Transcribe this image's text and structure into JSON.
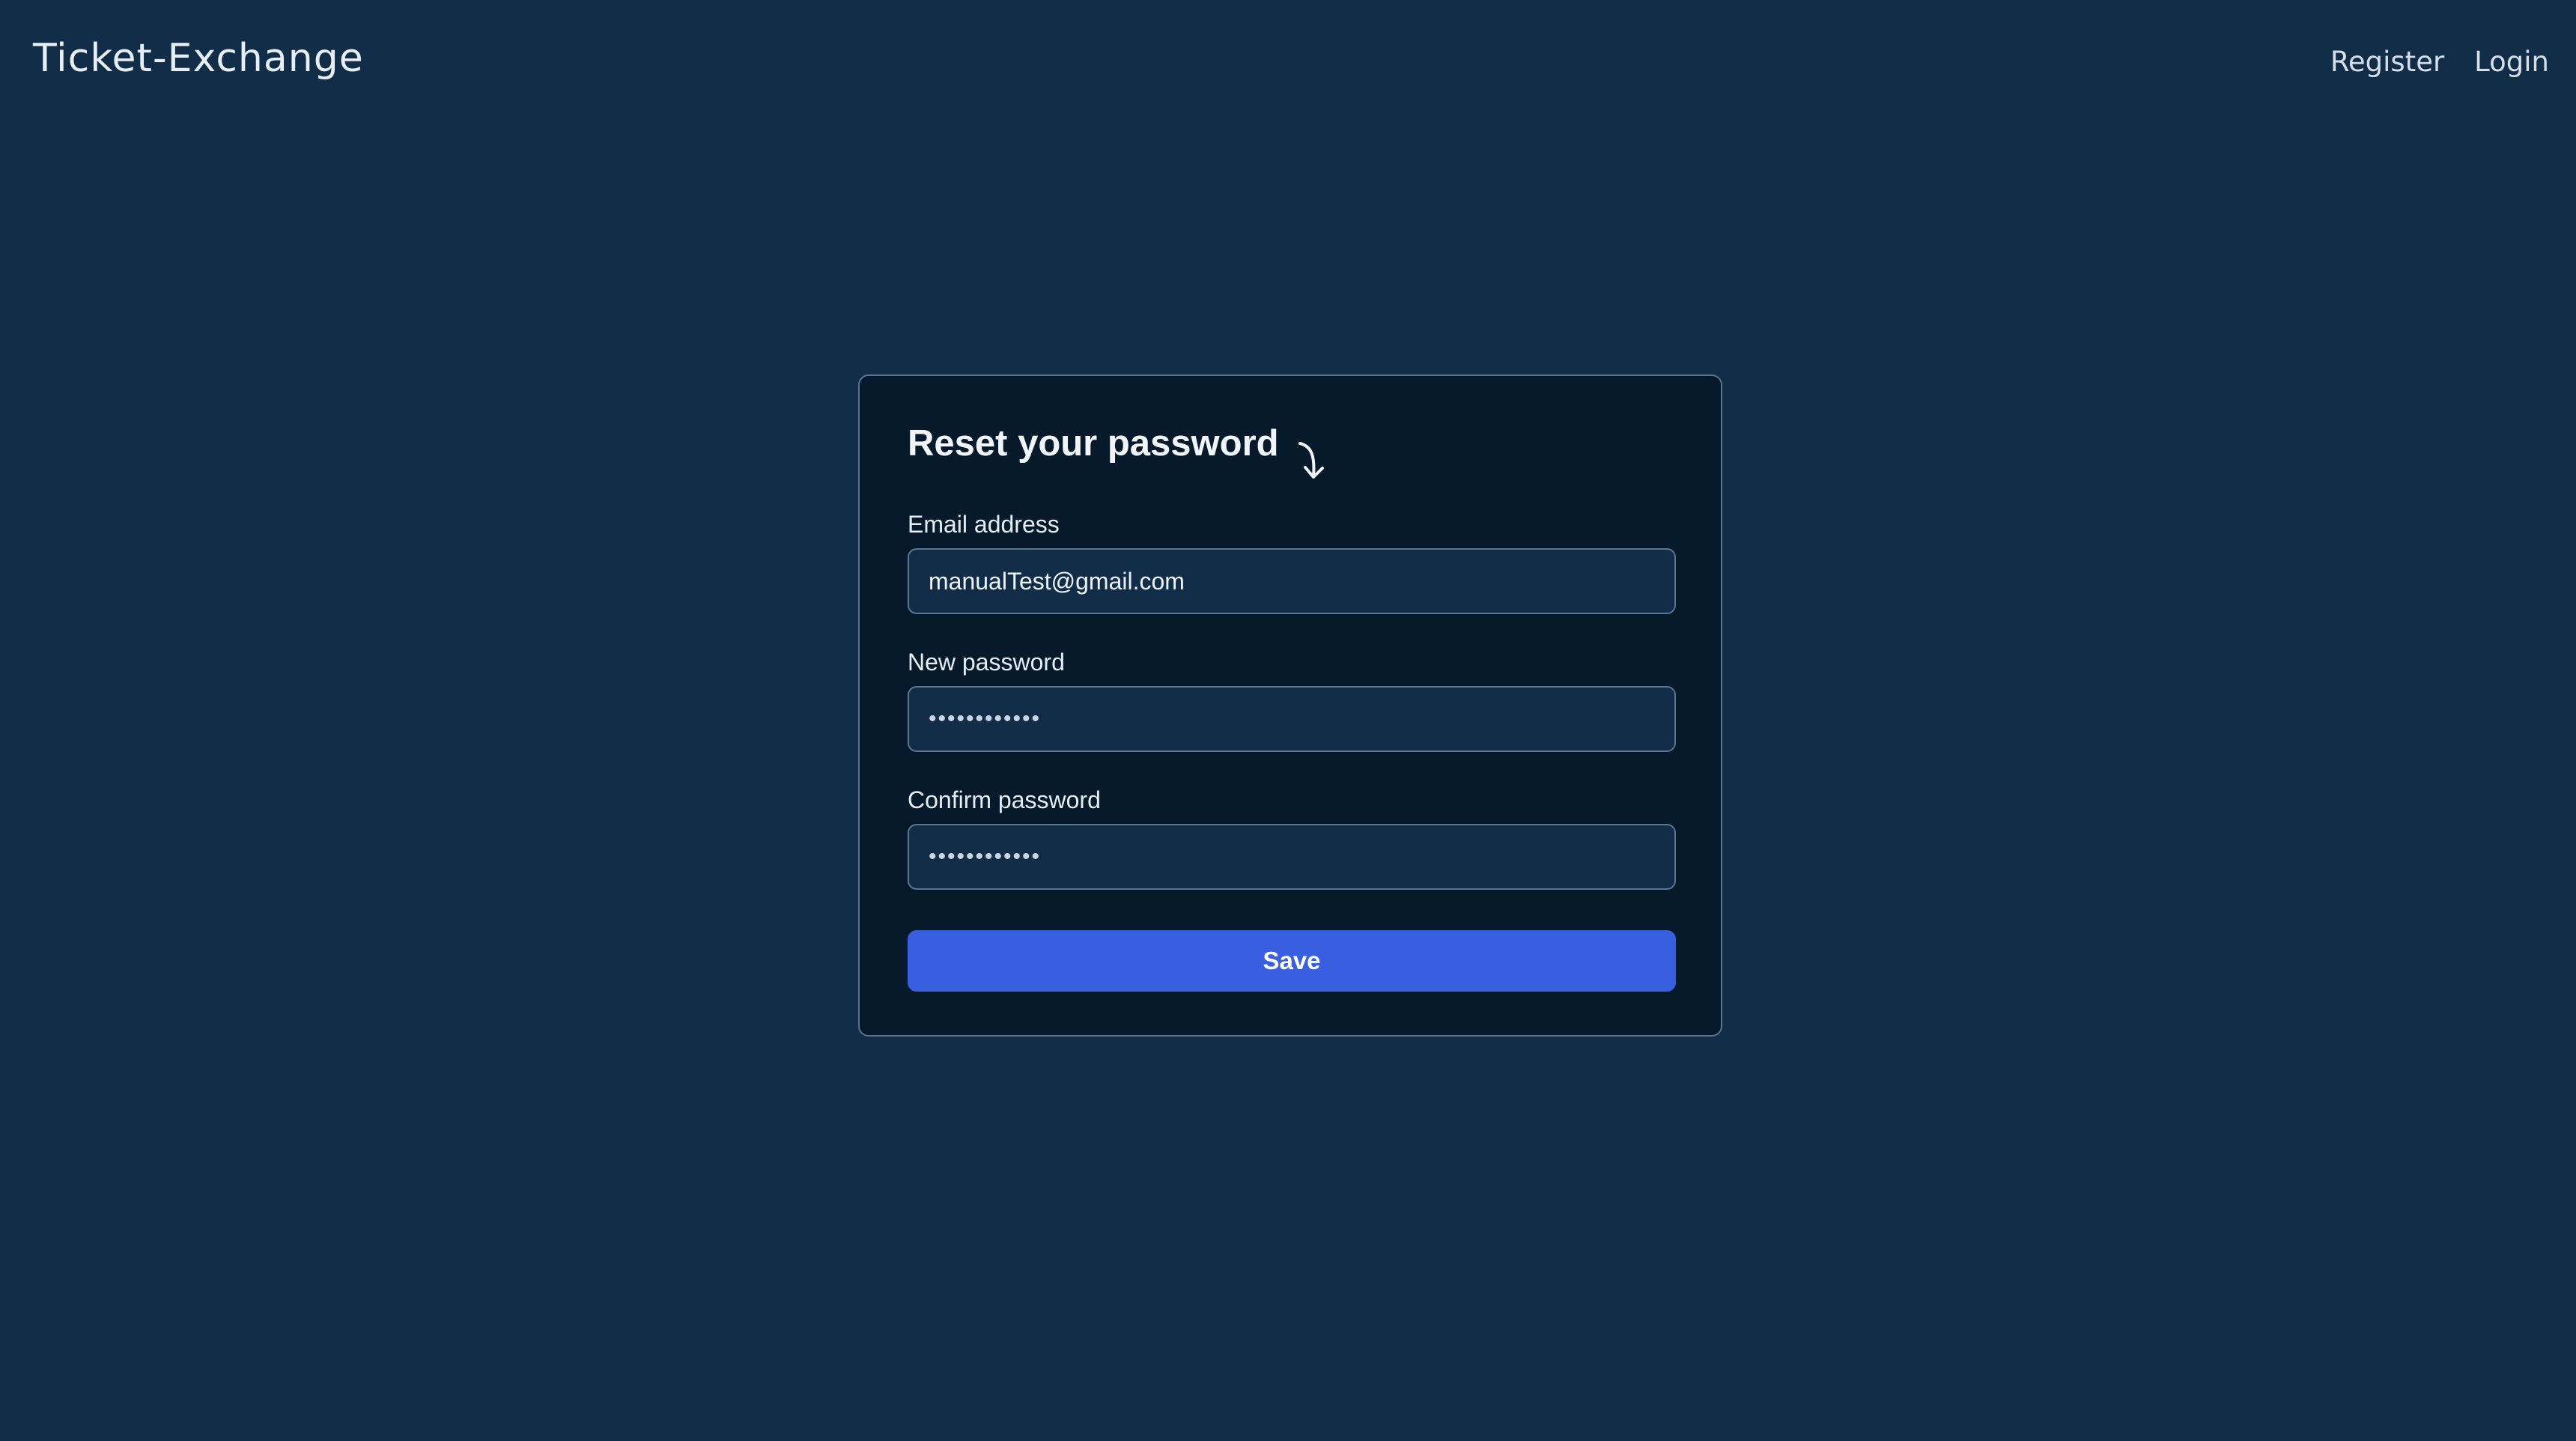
{
  "header": {
    "brand": "Ticket-Exchange",
    "nav": {
      "register": "Register",
      "login": "Login"
    }
  },
  "form": {
    "title": "Reset your password",
    "title_icon": "curved-arrow-down-icon",
    "email": {
      "label": "Email address",
      "value": "manualTest@gmail.com"
    },
    "new_password": {
      "label": "New password",
      "value": "••••••••••••"
    },
    "confirm_password": {
      "label": "Confirm password",
      "value": "••••••••••••"
    },
    "save_label": "Save"
  },
  "colors": {
    "background": "#112d48",
    "card": "#071a2b",
    "accent": "#385fe0"
  }
}
